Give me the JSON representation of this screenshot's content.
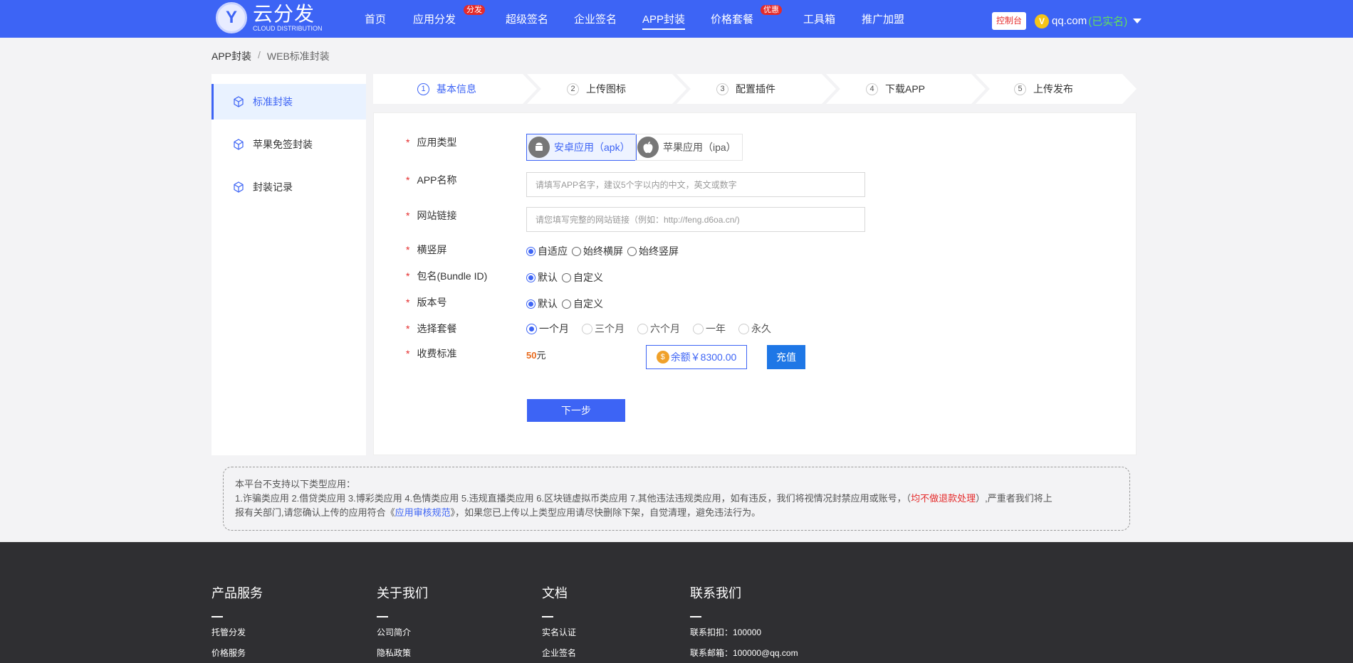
{
  "header": {
    "logo_mark": "Y",
    "logo_main": "云分发",
    "logo_sub": "CLOUD DISTRIBUTION",
    "nav": [
      {
        "label": "首页"
      },
      {
        "label": "应用分发",
        "badge": "分发"
      },
      {
        "label": "超级签名"
      },
      {
        "label": "企业签名"
      },
      {
        "label": "APP封装"
      },
      {
        "label": "价格套餐",
        "badge": "优惠"
      },
      {
        "label": "工具箱"
      },
      {
        "label": "推广加盟"
      }
    ],
    "console": "控制台",
    "vip": "V",
    "user": "qq.com",
    "verified": "(已实名)"
  },
  "breadcrumb": {
    "root": "APP封装",
    "sep": "/",
    "current": "WEB标准封装"
  },
  "sidebar": {
    "items": [
      {
        "label": "标准封装"
      },
      {
        "label": "苹果免签封装"
      },
      {
        "label": "封装记录"
      }
    ]
  },
  "steps": [
    {
      "num": "1",
      "label": "基本信息"
    },
    {
      "num": "2",
      "label": "上传图标"
    },
    {
      "num": "3",
      "label": "配置插件"
    },
    {
      "num": "4",
      "label": "下载APP"
    },
    {
      "num": "5",
      "label": "上传发布"
    }
  ],
  "form": {
    "required_mark": "*",
    "app_type": {
      "label": "应用类型",
      "android": "安卓应用（apk）",
      "ios": "苹果应用（ipa）"
    },
    "app_name": {
      "label": "APP名称",
      "placeholder": "请填写APP名字，建议5个字以内的中文，英文或数字"
    },
    "site_url": {
      "label": "网站链接",
      "placeholder": "请您填写完整的网站链接（例如：http://feng.d6oa.cn/)"
    },
    "orientation": {
      "label": "横竖屏",
      "options": [
        "自适应",
        "始终横屏",
        "始终竖屏"
      ]
    },
    "bundle": {
      "label": "包名(Bundle ID)",
      "options": [
        "默认",
        "自定义"
      ]
    },
    "version": {
      "label": "版本号",
      "options": [
        "默认",
        "自定义"
      ]
    },
    "plan": {
      "label": "选择套餐",
      "options": [
        "一个月",
        "三个月",
        "六个月",
        "一年",
        "永久"
      ]
    },
    "fee": {
      "label": "收费标准",
      "amount": "50",
      "unit": "元"
    },
    "balance": "余额￥8300.00",
    "coin": "$",
    "recharge": "充值",
    "next": "下一步"
  },
  "notice": {
    "line1": "本平台不支持以下类型应用：",
    "line2_a": "1.诈骗类应用 2.借贷类应用 3.博彩类应用 4.色情类应用 5.违规直播类应用 6.区块链虚拟币类应用 7.其他违法违规类应用，如有违反，我们将视情况封禁应用或账号，（",
    "line2_red": "均不做退款处理",
    "line2_b": "）,严重者我们将上",
    "line3_a": "报有关部门,请您确认上传的应用符合《",
    "line3_link": "应用审核规范",
    "line3_b": "》，如果您已上传以上类型应用请尽快删除下架，自觉清理，避免违法行为。"
  },
  "footer": {
    "cols": [
      {
        "title": "产品服务",
        "links": [
          "托管分发",
          "价格服务"
        ]
      },
      {
        "title": "关于我们",
        "links": [
          "公司简介",
          "隐私政策"
        ]
      },
      {
        "title": "文档",
        "links": [
          "实名认证",
          "企业签名"
        ]
      },
      {
        "title": "联系我们",
        "links": [
          "联系扣扣：100000",
          "联系邮箱：100000@qq.com"
        ]
      }
    ]
  }
}
